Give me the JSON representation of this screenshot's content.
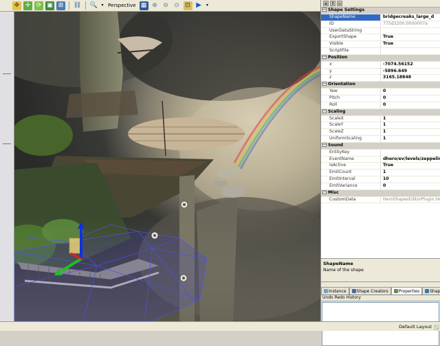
{
  "toolbar": {
    "perspective_label": "Perspective"
  },
  "properties": {
    "categories": [
      {
        "name": "Shape Settings",
        "rows": [
          {
            "label": "ShapeName",
            "value": "bridgecreaks_large_d",
            "selected": true
          },
          {
            "label": "ID",
            "value": "775d3200:0000007a",
            "dim": true
          },
          {
            "label": "UserDataString",
            "value": ""
          },
          {
            "label": "ExportShape",
            "value": "True"
          },
          {
            "label": "Visible",
            "value": "True"
          },
          {
            "label": "ScriptFile",
            "value": ""
          }
        ]
      },
      {
        "name": "Position",
        "rows": [
          {
            "label": "x",
            "value": "-7074.56152"
          },
          {
            "label": "y",
            "value": "-5896.649"
          },
          {
            "label": "z",
            "value": "3165.18848"
          }
        ]
      },
      {
        "name": "Orientation",
        "rows": [
          {
            "label": "Yaw",
            "value": "0"
          },
          {
            "label": "Pitch",
            "value": "0"
          },
          {
            "label": "Roll",
            "value": "0"
          }
        ]
      },
      {
        "name": "Scaling",
        "rows": [
          {
            "label": "ScaleX",
            "value": "1"
          },
          {
            "label": "ScaleY",
            "value": "1"
          },
          {
            "label": "ScaleZ",
            "value": "1"
          },
          {
            "label": "UniformScaling",
            "value": "1"
          }
        ]
      },
      {
        "name": "Sound",
        "rows": [
          {
            "label": "EntityKey",
            "value": ""
          },
          {
            "label": "EventName",
            "value": "dhero/ev/levels/zeppelin/amb"
          },
          {
            "label": "IsActive",
            "value": "True"
          },
          {
            "label": "EmitCount",
            "value": "1"
          },
          {
            "label": "EmitInterval",
            "value": "10"
          },
          {
            "label": "EmitVariance",
            "value": "0"
          }
        ]
      },
      {
        "name": "Misc",
        "rows": [
          {
            "label": "CustomData",
            "value": "HeroShapesEditorPlugin.HeroS",
            "dim": true
          }
        ]
      }
    ]
  },
  "help": {
    "title": "ShapeName",
    "description": "Name of the shape"
  },
  "tabs": [
    {
      "label": "Instance",
      "icon_color": "#7a9cc6"
    },
    {
      "label": "Shape Creators",
      "icon_color": "#4a6a9a"
    },
    {
      "label": "Properties",
      "icon_color": "#6a8a4a",
      "active": true
    },
    {
      "label": "Shape Search",
      "icon_color": "#2a7ac0"
    }
  ],
  "undo_redo": {
    "title": "Undo Redo History"
  },
  "statusbar": {
    "layout_label": "Default Layout"
  }
}
